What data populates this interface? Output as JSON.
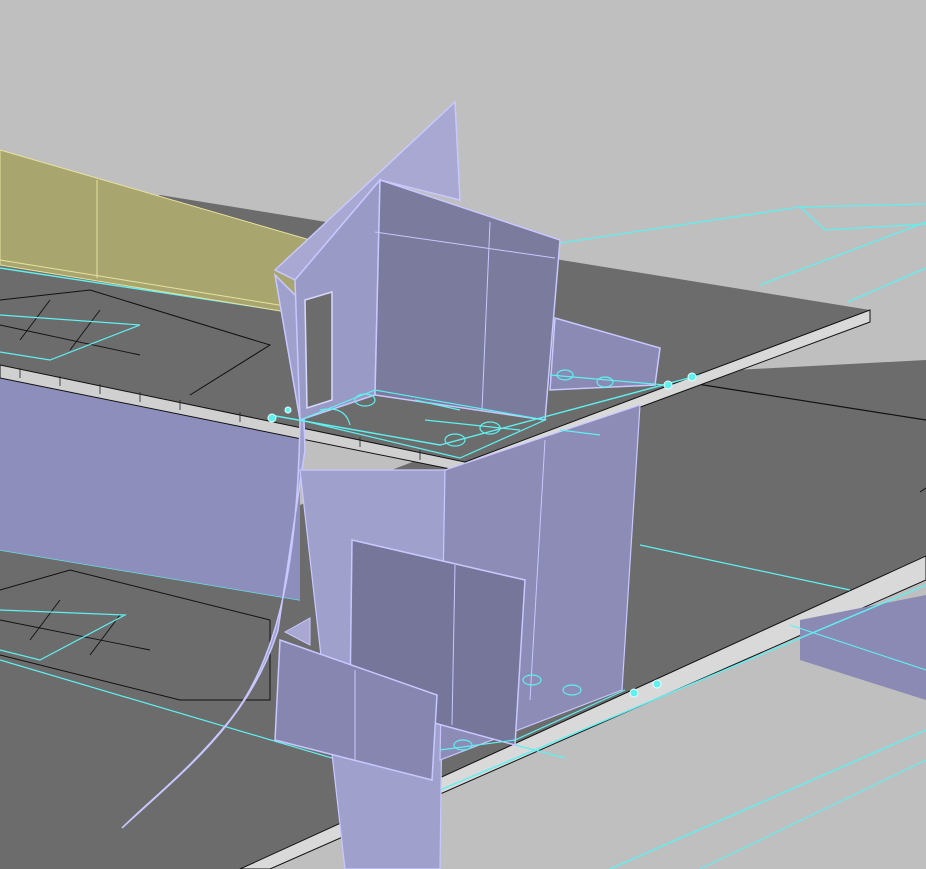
{
  "viewport": {
    "type": "3d-model-viewport",
    "view": "perspective",
    "display_mode": "shaded"
  },
  "colors": {
    "background": "#bfbfbf",
    "slab": "#6c6c6c",
    "slab_edge": "#d9d9d9",
    "wall_fill": "#9e9ec6",
    "wall_dark": "#7a7a9c",
    "wall_edge": "#c8c8ff",
    "selected_roof": "#a9a56e",
    "curve_lines": "#5ff0f0",
    "black_edge": "#111111"
  },
  "scene_objects": [
    "upper-floor-slab",
    "lower-floor-slab",
    "main-tower-core",
    "curved-shell-wall",
    "upper-right-partition",
    "mid-partition-panel",
    "lower-left-partition",
    "selected-roof-surface",
    "restroom-fixture-plan",
    "control-points"
  ]
}
